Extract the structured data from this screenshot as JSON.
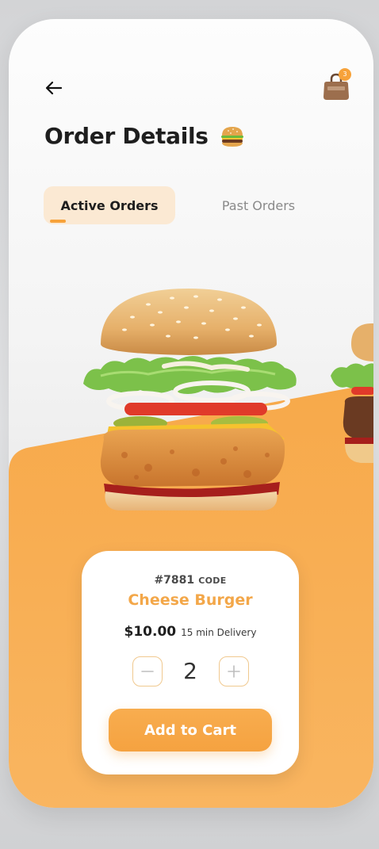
{
  "header": {
    "title": "Order Details",
    "cart_count": "3"
  },
  "tabs": [
    {
      "label": "Active Orders",
      "active": true
    },
    {
      "label": "Past Orders",
      "active": false
    }
  ],
  "product": {
    "code_number": "#7881",
    "code_label": "CODE",
    "name": "Cheese Burger",
    "price": "$10.00",
    "delivery": "15 min Delivery",
    "quantity": "2",
    "add_label": "Add to Cart"
  },
  "icons": {
    "back": "arrow-left-icon",
    "bag": "shopping-bag-icon",
    "emoji": "hamburger-emoji-icon",
    "minus": "minus-icon",
    "plus": "plus-icon"
  },
  "colors": {
    "accent": "#f7a23a",
    "product_name": "#f3a749",
    "tab_active_bg": "#fbe9d3"
  }
}
